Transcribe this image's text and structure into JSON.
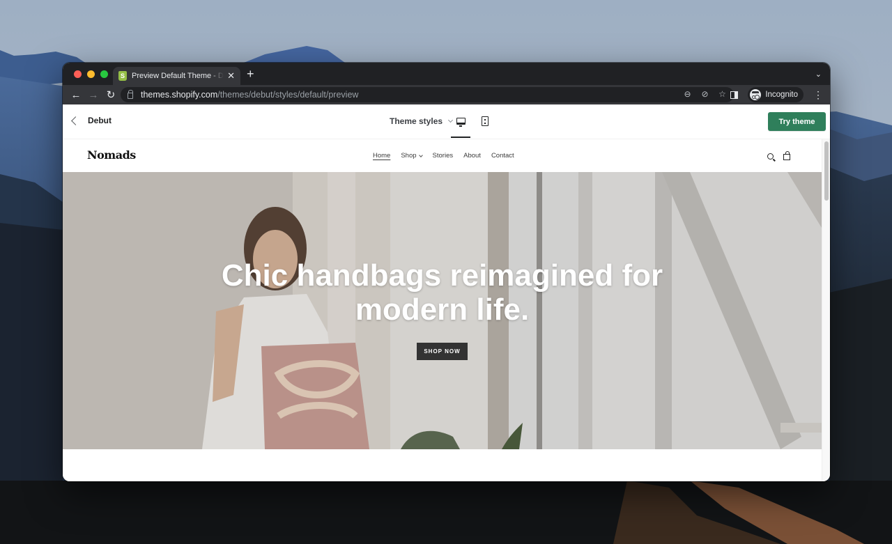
{
  "browser": {
    "tab": {
      "title": "Preview Default Theme - Debut",
      "favicon": "shopify-bag-icon"
    },
    "new_tab_symbol": "+",
    "tab_close_symbol": "✕",
    "tab_menu_symbol": "⌄",
    "url": {
      "host": "themes.shopify.com",
      "path": "/themes/debut/styles/default/preview"
    },
    "nav": {
      "back": "←",
      "forward": "→",
      "reload": "↻"
    },
    "omnibox_icons": [
      "zoom-icon",
      "eye-off-icon",
      "bookmark-star-icon"
    ],
    "omnibox_icon_glyphs": [
      "⊖",
      "⊘",
      "☆"
    ],
    "profile_label": "Incognito",
    "menu_glyph": "⋮"
  },
  "preview_bar": {
    "back_label": "Debut",
    "theme_styles_label": "Theme styles",
    "active_view": "desktop",
    "try_button_label": "Try theme",
    "accent_color": "#2f7f5b"
  },
  "store": {
    "logo": "Nomads",
    "nav": [
      {
        "label": "Home",
        "active": true
      },
      {
        "label": "Shop",
        "dropdown": true
      },
      {
        "label": "Stories"
      },
      {
        "label": "About"
      },
      {
        "label": "Contact"
      }
    ],
    "hero": {
      "heading_line1": "Chic handbags reimagined for",
      "heading_line2": "modern life.",
      "cta_label": "SHOP NOW"
    }
  }
}
